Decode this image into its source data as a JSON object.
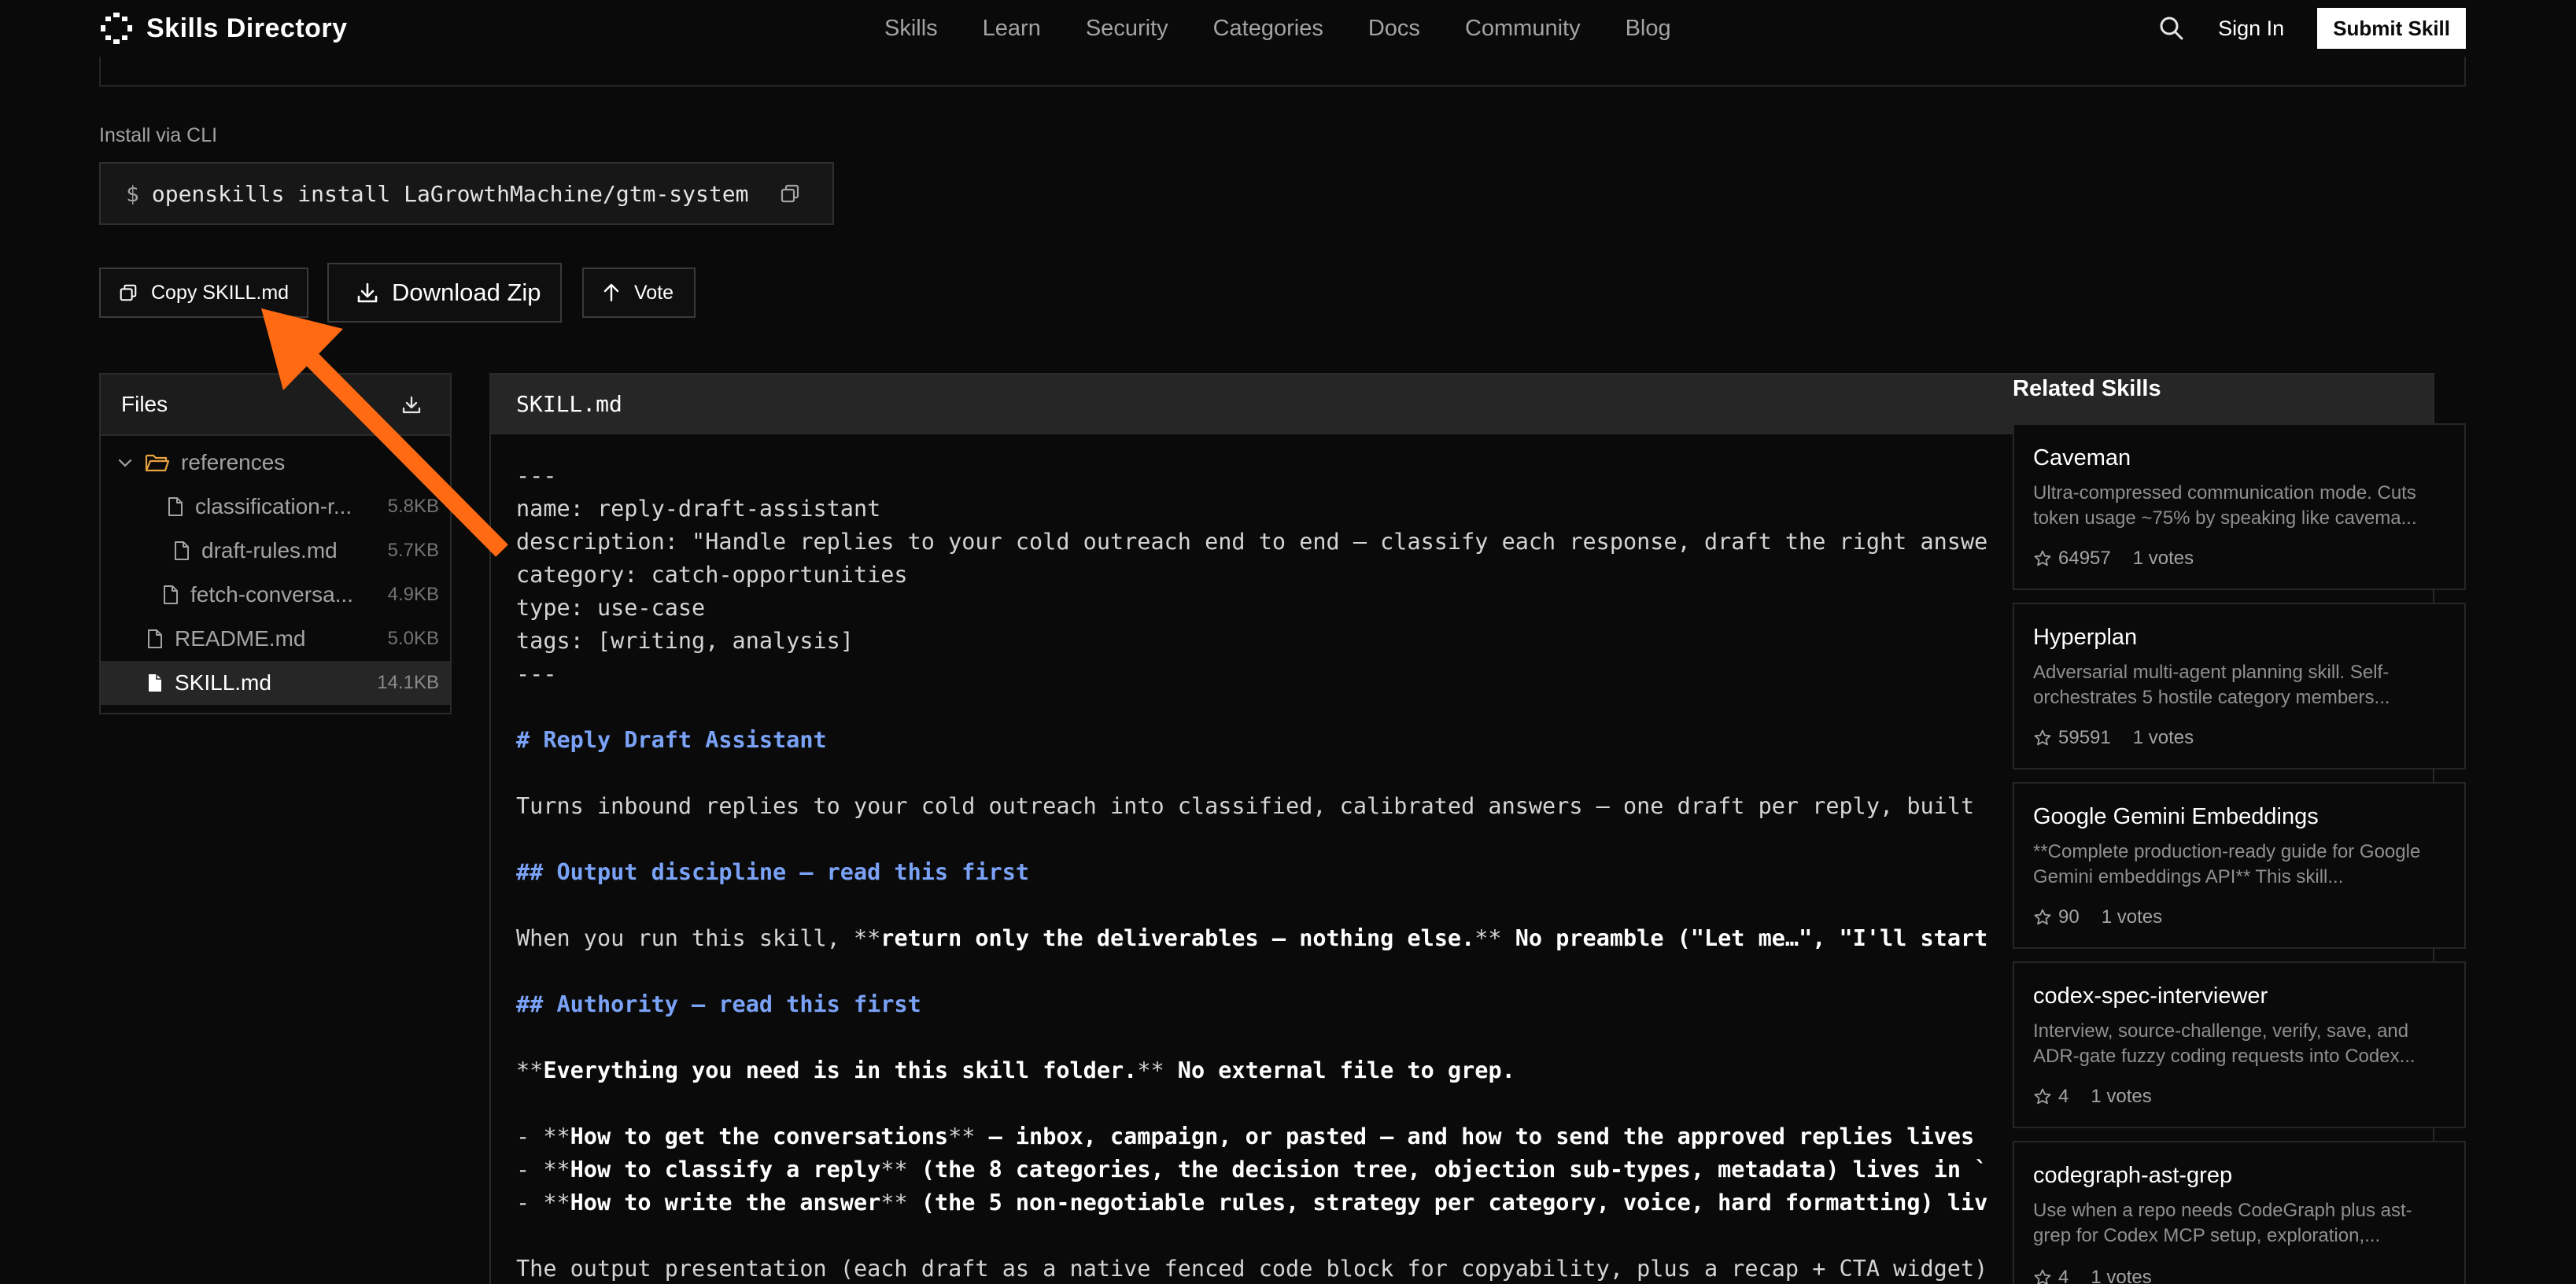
{
  "header": {
    "logo_text": "Skills Directory",
    "nav": [
      "Skills",
      "Learn",
      "Security",
      "Categories",
      "Docs",
      "Community",
      "Blog"
    ],
    "sign_in": "Sign In",
    "submit": "Submit Skill"
  },
  "install": {
    "label": "Install via CLI",
    "prompt": "$",
    "command": "openskills install LaGrowthMachine/gtm-system"
  },
  "actions": {
    "copy": "Copy SKILL.md",
    "download": "Download Zip",
    "vote": "Vote"
  },
  "files": {
    "title": "Files",
    "items": [
      {
        "name": "references",
        "type": "folder",
        "size": ""
      },
      {
        "name": "classification-r...",
        "type": "file",
        "size": "5.8KB"
      },
      {
        "name": "draft-rules.md",
        "type": "file",
        "size": "5.7KB"
      },
      {
        "name": "fetch-conversa...",
        "type": "file",
        "size": "4.9KB"
      },
      {
        "name": "README.md",
        "type": "file",
        "size": "5.0KB"
      },
      {
        "name": "SKILL.md",
        "type": "file",
        "size": "14.1KB",
        "active": true
      }
    ]
  },
  "editor": {
    "title": "SKILL.md",
    "lines": [
      "---",
      "name: reply-draft-assistant",
      "description: \"Handle replies to your cold outreach end to end — classify each response, draft the right answe",
      "category: catch-opportunities",
      "type: use-case",
      "tags: [writing, analysis]",
      "---",
      "",
      "# Reply Draft Assistant",
      "",
      "Turns inbound replies to your cold outreach into classified, calibrated answers — one draft per reply, built",
      "",
      "## Output discipline — read this first",
      "",
      "When you run this skill, **return only the deliverables — nothing else.** No preamble (\"Let me…\", \"I'll start",
      "",
      "## Authority — read this first",
      "",
      "**Everything you need is in this skill folder.** No external file to grep.",
      "",
      "- **How to get the conversations** — inbox, campaign, or pasted — and how to send the approved replies lives",
      "- **How to classify a reply** (the 8 categories, the decision tree, objection sub-types, metadata) lives in `",
      "- **How to write the answer** (the 5 non-negotiable rules, strategy per category, voice, hard formatting) liv",
      "",
      "The output presentation (each draft as a native fenced code block for copyability, plus a recap + CTA widget)"
    ]
  },
  "related": {
    "title": "Related Skills",
    "items": [
      {
        "name": "Caveman",
        "desc": "Ultra-compressed communication mode. Cuts token usage ~75% by speaking like cavema...",
        "stars": "64957",
        "votes": "1 votes"
      },
      {
        "name": "Hyperplan",
        "desc": "Adversarial multi-agent planning skill. Self-orchestrates 5 hostile category members...",
        "stars": "59591",
        "votes": "1 votes"
      },
      {
        "name": "Google Gemini Embeddings",
        "desc": "**Complete production-ready guide for Google Gemini embeddings API** This skill...",
        "stars": "90",
        "votes": "1 votes"
      },
      {
        "name": "codex-spec-interviewer",
        "desc": "Interview, source-challenge, verify, save, and ADR-gate fuzzy coding requests into Codex...",
        "stars": "4",
        "votes": "1 votes"
      },
      {
        "name": "codegraph-ast-grep",
        "desc": "Use when a repo needs CodeGraph plus ast-grep for Codex MCP setup, exploration,...",
        "stars": "4",
        "votes": "1 votes"
      }
    ]
  },
  "colors": {
    "accent_arrow": "#ff6a13",
    "heading": "#7aa2f7",
    "folder": "#e8a33d"
  }
}
